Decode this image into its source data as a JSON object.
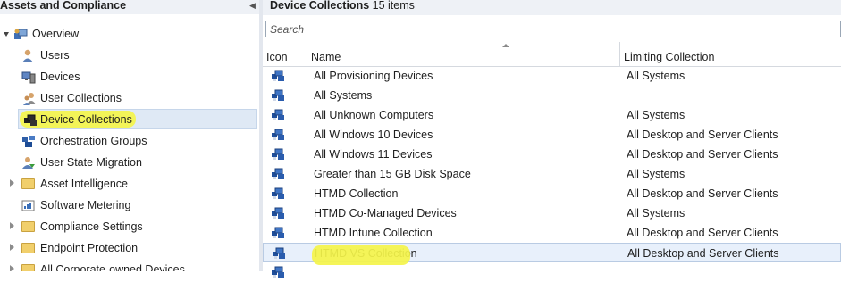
{
  "nav": {
    "title": "Assets and Compliance",
    "items": [
      {
        "label": "Overview",
        "icon": "overview-icon"
      },
      {
        "label": "Users",
        "icon": "user-icon"
      },
      {
        "label": "Devices",
        "icon": "devices-icon"
      },
      {
        "label": "User Collections",
        "icon": "user-collections-icon"
      },
      {
        "label": "Device Collections",
        "icon": "device-collections-icon"
      },
      {
        "label": "Orchestration Groups",
        "icon": "orchestration-groups-icon"
      },
      {
        "label": "User State Migration",
        "icon": "user-state-migration-icon"
      },
      {
        "label": "Asset Intelligence",
        "icon": "folder-icon"
      },
      {
        "label": "Software Metering",
        "icon": "software-metering-icon"
      },
      {
        "label": "Compliance Settings",
        "icon": "folder-icon"
      },
      {
        "label": "Endpoint Protection",
        "icon": "folder-icon"
      },
      {
        "label": "All Corporate-owned Devices",
        "icon": "folder-icon"
      }
    ]
  },
  "content": {
    "title": "Device Collections",
    "count": "15 items",
    "search_placeholder": "Search",
    "columns": {
      "icon": "Icon",
      "name": "Name",
      "limiting": "Limiting Collection"
    },
    "rows": [
      {
        "name": "All Provisioning Devices",
        "limiting": "All Systems"
      },
      {
        "name": "All Systems",
        "limiting": ""
      },
      {
        "name": "All Unknown Computers",
        "limiting": "All Systems"
      },
      {
        "name": "All Windows 10 Devices",
        "limiting": "All Desktop and Server Clients"
      },
      {
        "name": "All Windows 11 Devices",
        "limiting": "All Desktop and Server Clients"
      },
      {
        "name": "Greater than 15 GB Disk Space",
        "limiting": "All Systems"
      },
      {
        "name": "HTMD Collection",
        "limiting": "All Desktop and Server Clients"
      },
      {
        "name": "HTMD Co-Managed Devices",
        "limiting": "All Systems"
      },
      {
        "name": "HTMD Intune Collection",
        "limiting": "All Desktop and Server Clients"
      },
      {
        "name": "HTMD VS Collection",
        "limiting": "All Desktop and Server Clients"
      }
    ]
  },
  "colors": {
    "highlight": "#f4f44a",
    "selection": "#dfe9f5",
    "header_bg": "#eef1f6"
  }
}
